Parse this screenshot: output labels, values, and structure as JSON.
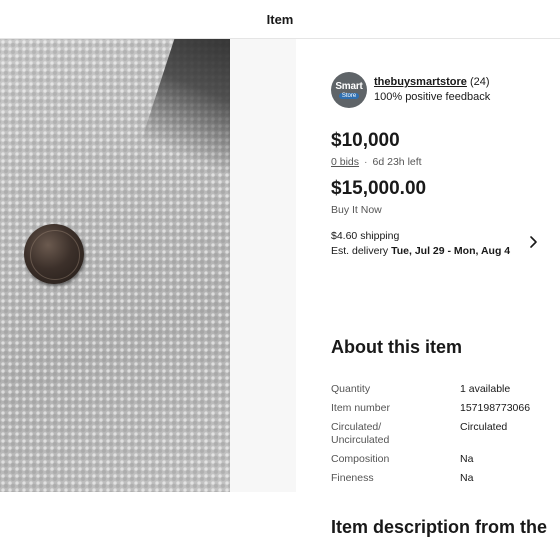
{
  "header": {
    "title": "Item"
  },
  "photo": {
    "alt": "coin-photo"
  },
  "seller": {
    "avatar_main": "Smart",
    "avatar_sub": "Store",
    "name": "thebuysmartstore",
    "count": "(24)",
    "feedback": "100% positive feedback"
  },
  "auction": {
    "price": "$10,000",
    "bids": "0 bids",
    "separator": "·",
    "time_left": "6d 23h left"
  },
  "buy_it_now": {
    "price": "$15,000.00",
    "label": "Buy It Now"
  },
  "shipping": {
    "cost": "$4.60 shipping",
    "delivery_prefix": "Est. delivery",
    "delivery_dates": "Tue, Jul 29 - Mon, Aug 4"
  },
  "about": {
    "title": "About this item",
    "specs": [
      {
        "label": "Quantity",
        "value": "1 available"
      },
      {
        "label": "Item number",
        "value": "157198773066"
      },
      {
        "label": "Circulated/ Uncirculated",
        "value": "Circulated"
      },
      {
        "label": "Composition",
        "value": "Na"
      },
      {
        "label": "Fineness",
        "value": "Na"
      }
    ]
  },
  "description": {
    "title": "Item description from the"
  },
  "colors": {
    "text": "#191919",
    "secondary": "#555555",
    "avatar": "#5f6468"
  },
  "icons": [
    "chevron-right-icon"
  ]
}
